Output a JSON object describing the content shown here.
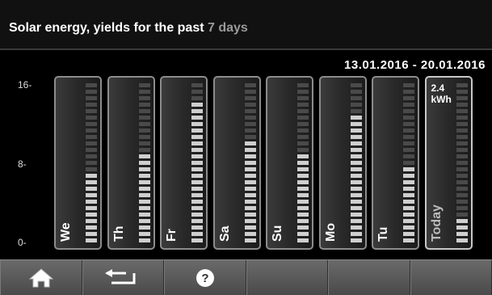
{
  "header": {
    "title_prefix": "Solar energy, yields for the past ",
    "title_highlight": "7 days"
  },
  "date_range": "13.01.2016 - 20.01.2016",
  "today_value": "2.4\nkWh",
  "chart_data": {
    "type": "bar",
    "categories": [
      "We",
      "Th",
      "Fr",
      "Sa",
      "Su",
      "Mo",
      "Tu",
      "Today"
    ],
    "values": [
      7.0,
      9.0,
      14.0,
      10.5,
      9.0,
      12.5,
      7.5,
      2.4
    ],
    "y_ticks": [
      "16-",
      "8-",
      "0-"
    ],
    "ylim": [
      0,
      16
    ],
    "unit": "kWh",
    "colors": {
      "filled": "#cfcfcf",
      "empty": "#4a4a4a"
    }
  },
  "footer": {
    "buttons": [
      {
        "icon": "home-icon"
      },
      {
        "icon": "back-arrow-icon"
      },
      {
        "icon": "help-icon"
      },
      {
        "icon": ""
      },
      {
        "icon": ""
      },
      {
        "icon": ""
      }
    ]
  }
}
